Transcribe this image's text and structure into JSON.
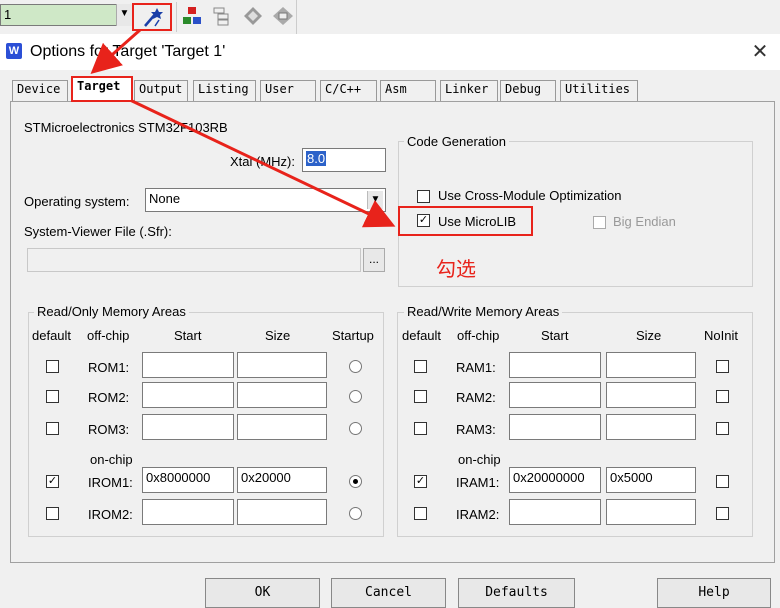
{
  "toolbar": {
    "target_combo_value": "1"
  },
  "window": {
    "title": "Options for Target 'Target 1'",
    "close": "✕"
  },
  "tabs": [
    "Device",
    "Target",
    "Output",
    "Listing",
    "User",
    "C/C++",
    "Asm",
    "Linker",
    "Debug",
    "Utilities"
  ],
  "target": {
    "device_name": "STMicroelectronics STM32F103RB",
    "xtal_label": "Xtal (MHz):",
    "xtal_value": "8.0",
    "os_label": "Operating system:",
    "os_value": "None",
    "sysviewer_label": "System-Viewer File (.Sfr):",
    "browse": "..."
  },
  "codegen": {
    "title": "Code Generation",
    "cross_module": "Use Cross-Module Optimization",
    "microlib": "Use MicroLIB",
    "big_endian": "Big Endian"
  },
  "annotation": {
    "check_note": "勾选"
  },
  "rom": {
    "title": "Read/Only Memory Areas",
    "headers": {
      "default": "default",
      "offchip": "off-chip",
      "start": "Start",
      "size": "Size",
      "startup": "Startup"
    },
    "onchip": "on-chip",
    "rows": [
      {
        "name": "ROM1:",
        "start": "",
        "size": "",
        "checked": false,
        "startup": false
      },
      {
        "name": "ROM2:",
        "start": "",
        "size": "",
        "checked": false,
        "startup": false
      },
      {
        "name": "ROM3:",
        "start": "",
        "size": "",
        "checked": false,
        "startup": false
      },
      {
        "name": "IROM1:",
        "start": "0x8000000",
        "size": "0x20000",
        "checked": true,
        "startup": true
      },
      {
        "name": "IROM2:",
        "start": "",
        "size": "",
        "checked": false,
        "startup": false
      }
    ]
  },
  "ram": {
    "title": "Read/Write Memory Areas",
    "headers": {
      "default": "default",
      "offchip": "off-chip",
      "start": "Start",
      "size": "Size",
      "noinit": "NoInit"
    },
    "onchip": "on-chip",
    "rows": [
      {
        "name": "RAM1:",
        "start": "",
        "size": ""
      },
      {
        "name": "RAM2:",
        "start": "",
        "size": ""
      },
      {
        "name": "RAM3:",
        "start": "",
        "size": ""
      },
      {
        "name": "IRAM1:",
        "start": "0x20000000",
        "size": "0x5000",
        "checked": true
      },
      {
        "name": "IRAM2:",
        "start": "",
        "size": ""
      }
    ]
  },
  "buttons": {
    "ok": "OK",
    "cancel": "Cancel",
    "defaults": "Defaults",
    "help": "Help"
  },
  "colors": {
    "annotation_red": "#e8231b"
  }
}
